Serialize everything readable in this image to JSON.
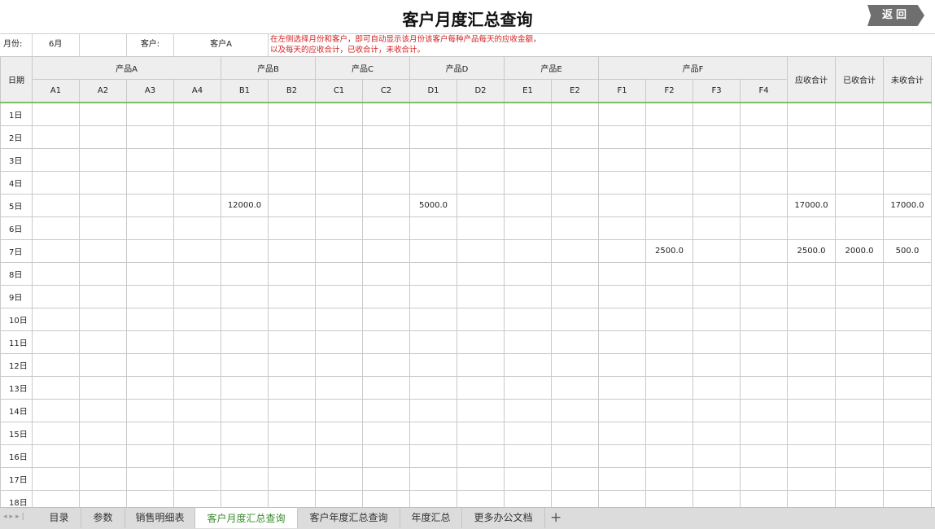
{
  "header": {
    "title": "客户月度汇总查询",
    "back_label": "返回"
  },
  "filter": {
    "month_label": "月份:",
    "month_value": "6月",
    "customer_label": "客户:",
    "customer_value": "客户A",
    "note_line1": "在左侧选择月份和客户，即可自动显示该月份该客户每种产品每天的应收金额，",
    "note_line2": "以及每天的应收合计，已收合计，未收合计。"
  },
  "table": {
    "date_header": "日期",
    "groups": [
      {
        "name": "产品A",
        "subs": [
          "A1",
          "A2",
          "A3",
          "A4"
        ]
      },
      {
        "name": "产品B",
        "subs": [
          "B1",
          "B2"
        ]
      },
      {
        "name": "产品C",
        "subs": [
          "C1",
          "C2"
        ]
      },
      {
        "name": "产品D",
        "subs": [
          "D1",
          "D2"
        ]
      },
      {
        "name": "产品E",
        "subs": [
          "E1",
          "E2"
        ]
      },
      {
        "name": "产品F",
        "subs": [
          "F1",
          "F2",
          "F3",
          "F4"
        ]
      }
    ],
    "total_headers": [
      "应收合计",
      "已收合计",
      "未收合计"
    ],
    "rows": [
      {
        "day": "1日",
        "cells": [
          "",
          "",
          "",
          "",
          "",
          "",
          "",
          "",
          "",
          "",
          "",
          "",
          "",
          "",
          "",
          "",
          "",
          "",
          ""
        ]
      },
      {
        "day": "2日",
        "cells": [
          "",
          "",
          "",
          "",
          "",
          "",
          "",
          "",
          "",
          "",
          "",
          "",
          "",
          "",
          "",
          "",
          "",
          "",
          ""
        ]
      },
      {
        "day": "3日",
        "cells": [
          "",
          "",
          "",
          "",
          "",
          "",
          "",
          "",
          "",
          "",
          "",
          "",
          "",
          "",
          "",
          "",
          "",
          "",
          ""
        ]
      },
      {
        "day": "4日",
        "cells": [
          "",
          "",
          "",
          "",
          "",
          "",
          "",
          "",
          "",
          "",
          "",
          "",
          "",
          "",
          "",
          "",
          "",
          "",
          ""
        ]
      },
      {
        "day": "5日",
        "cells": [
          "",
          "",
          "",
          "",
          "12000.0",
          "",
          "",
          "",
          "5000.0",
          "",
          "",
          "",
          "",
          "",
          "",
          "",
          "17000.0",
          "",
          "17000.0"
        ]
      },
      {
        "day": "6日",
        "cells": [
          "",
          "",
          "",
          "",
          "",
          "",
          "",
          "",
          "",
          "",
          "",
          "",
          "",
          "",
          "",
          "",
          "",
          "",
          ""
        ]
      },
      {
        "day": "7日",
        "cells": [
          "",
          "",
          "",
          "",
          "",
          "",
          "",
          "",
          "",
          "",
          "",
          "",
          "",
          "2500.0",
          "",
          "",
          "2500.0",
          "2000.0",
          "500.0"
        ]
      },
      {
        "day": "8日",
        "cells": [
          "",
          "",
          "",
          "",
          "",
          "",
          "",
          "",
          "",
          "",
          "",
          "",
          "",
          "",
          "",
          "",
          "",
          "",
          ""
        ]
      },
      {
        "day": "9日",
        "cells": [
          "",
          "",
          "",
          "",
          "",
          "",
          "",
          "",
          "",
          "",
          "",
          "",
          "",
          "",
          "",
          "",
          "",
          "",
          ""
        ]
      },
      {
        "day": "10日",
        "cells": [
          "",
          "",
          "",
          "",
          "",
          "",
          "",
          "",
          "",
          "",
          "",
          "",
          "",
          "",
          "",
          "",
          "",
          "",
          ""
        ]
      },
      {
        "day": "11日",
        "cells": [
          "",
          "",
          "",
          "",
          "",
          "",
          "",
          "",
          "",
          "",
          "",
          "",
          "",
          "",
          "",
          "",
          "",
          "",
          ""
        ]
      },
      {
        "day": "12日",
        "cells": [
          "",
          "",
          "",
          "",
          "",
          "",
          "",
          "",
          "",
          "",
          "",
          "",
          "",
          "",
          "",
          "",
          "",
          "",
          ""
        ]
      },
      {
        "day": "13日",
        "cells": [
          "",
          "",
          "",
          "",
          "",
          "",
          "",
          "",
          "",
          "",
          "",
          "",
          "",
          "",
          "",
          "",
          "",
          "",
          ""
        ]
      },
      {
        "day": "14日",
        "cells": [
          "",
          "",
          "",
          "",
          "",
          "",
          "",
          "",
          "",
          "",
          "",
          "",
          "",
          "",
          "",
          "",
          "",
          "",
          ""
        ]
      },
      {
        "day": "15日",
        "cells": [
          "",
          "",
          "",
          "",
          "",
          "",
          "",
          "",
          "",
          "",
          "",
          "",
          "",
          "",
          "",
          "",
          "",
          "",
          ""
        ]
      },
      {
        "day": "16日",
        "cells": [
          "",
          "",
          "",
          "",
          "",
          "",
          "",
          "",
          "",
          "",
          "",
          "",
          "",
          "",
          "",
          "",
          "",
          "",
          ""
        ]
      },
      {
        "day": "17日",
        "cells": [
          "",
          "",
          "",
          "",
          "",
          "",
          "",
          "",
          "",
          "",
          "",
          "",
          "",
          "",
          "",
          "",
          "",
          "",
          ""
        ]
      },
      {
        "day": "18日",
        "cells": [
          "",
          "",
          "",
          "",
          "",
          "",
          "",
          "",
          "",
          "",
          "",
          "",
          "",
          "",
          "",
          "",
          "",
          "",
          ""
        ]
      }
    ]
  },
  "tabs": {
    "nav_icons": [
      "first-sheet-icon",
      "prev-sheet-icon",
      "next-sheet-icon",
      "last-sheet-icon"
    ],
    "items": [
      "目录",
      "参数",
      "销售明细表",
      "客户月度汇总查询",
      "客户年度汇总查询",
      "年度汇总",
      "更多办公文档"
    ],
    "active": "客户月度汇总查询",
    "add_label": "+"
  },
  "colors": {
    "note": "#d21f1f",
    "header_bg": "#eeeeee",
    "active_tab_text": "#3a8a2e",
    "back_button": "#6f6f6f"
  }
}
